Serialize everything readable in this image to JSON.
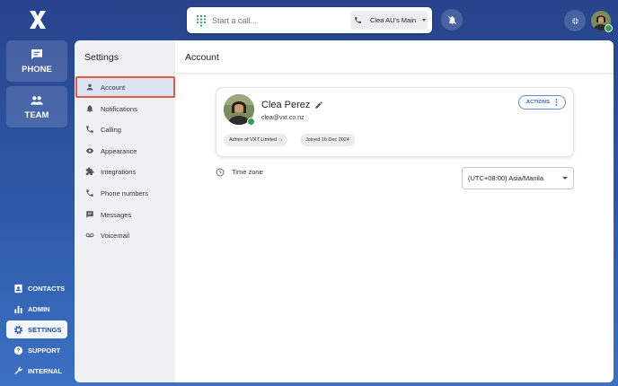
{
  "rail": {
    "phone_label": "PHONE",
    "team_label": "TEAM",
    "bottom_items": [
      {
        "label": "CONTACTS",
        "icon": "contacts-icon"
      },
      {
        "label": "ADMIN",
        "icon": "bar-chart-icon"
      },
      {
        "label": "SETTINGS",
        "icon": "gear-icon",
        "active": true
      },
      {
        "label": "SUPPORT",
        "icon": "help-icon"
      },
      {
        "label": "INTERNAL",
        "icon": "wrench-icon"
      }
    ]
  },
  "callbar": {
    "placeholder": "Start a call...",
    "line_label": "Clea AU's Main"
  },
  "settings": {
    "title": "Settings",
    "items": [
      {
        "label": "Account",
        "icon": "person-icon",
        "active": true
      },
      {
        "label": "Notifications",
        "icon": "bell-icon"
      },
      {
        "label": "Calling",
        "icon": "phone-icon"
      },
      {
        "label": "Appearance",
        "icon": "eye-icon"
      },
      {
        "label": "Integrations",
        "icon": "puzzle-icon"
      },
      {
        "label": "Phone numbers",
        "icon": "phone-icon"
      },
      {
        "label": "Messages",
        "icon": "message-icon"
      },
      {
        "label": "Voicemail",
        "icon": "voicemail-icon"
      }
    ]
  },
  "account": {
    "title": "Account",
    "name": "Clea Perez",
    "email": "clea@vxt.co.nz",
    "admin_chip": "Admin of VXT Limited",
    "joined_chip": "Joined 16 Dec 2024",
    "actions_label": "ACTIONS",
    "timezone_label": "Time zone",
    "timezone_value": "(UTC+08:00) Asia/Manila"
  },
  "colors": {
    "accent": "#2e64b8",
    "status_online": "#2e9d54",
    "highlight_border": "#e25a44"
  }
}
